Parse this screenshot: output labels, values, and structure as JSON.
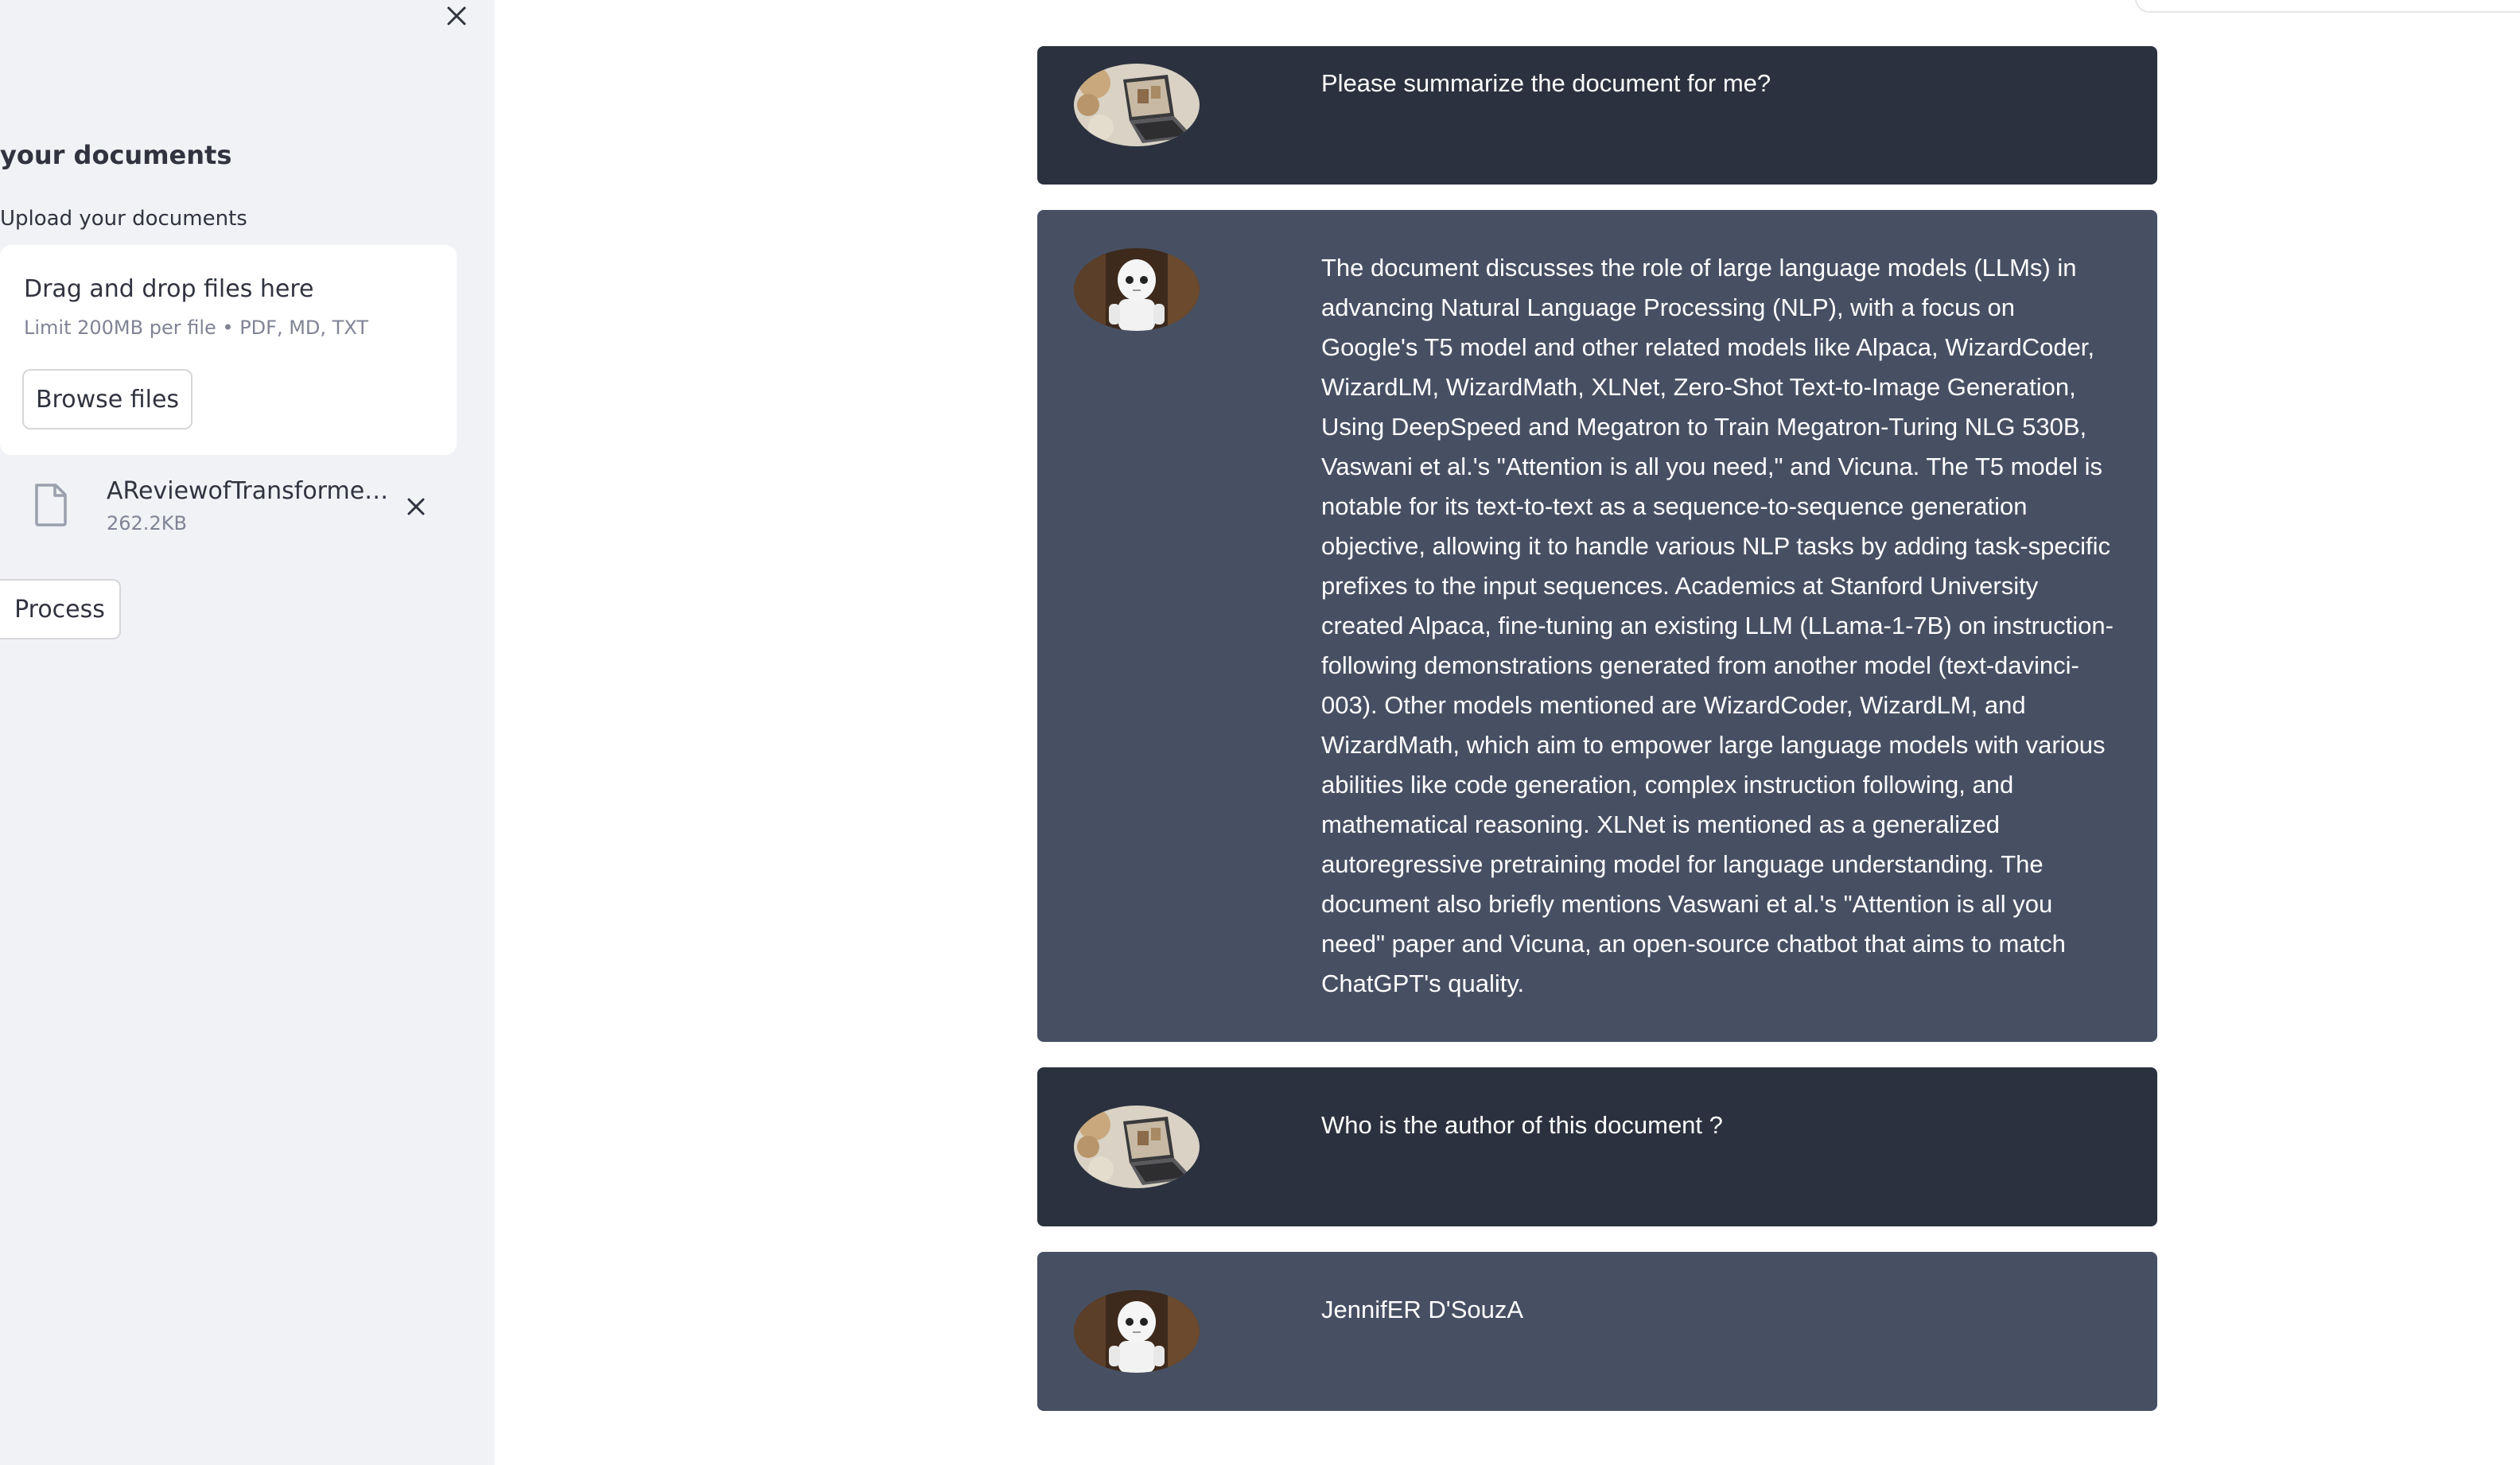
{
  "sidebar": {
    "title": "your documents",
    "upload_label": "Upload your documents",
    "dropzone": {
      "title": "Drag and drop files here",
      "limit": "Limit 200MB per file • PDF, MD, TXT",
      "browse_label": "Browse files"
    },
    "file": {
      "name": "AReviewofTransformerM...",
      "size": "262.2KB"
    },
    "process_label": "Process"
  },
  "chat": {
    "messages": [
      {
        "role": "user",
        "avatar": "user-laptop-avatar",
        "text": "Please summarize the document for me?"
      },
      {
        "role": "bot",
        "avatar": "bot-robot-avatar",
        "text": "The document discusses the role of large language models (LLMs) in advancing Natural Language Processing (NLP), with a focus on Google's T5 model and other related models like Alpaca, WizardCoder, WizardLM, WizardMath, XLNet, Zero-Shot Text-to-Image Generation, Using DeepSpeed and Megatron to Train Megatron-Turing NLG 530B, Vaswani et al.'s \"Attention is all you need,\" and Vicuna. The T5 model is notable for its text-to-text as a sequence-to-sequence generation objective, allowing it to handle various NLP tasks by adding task-specific prefixes to the input sequences. Academics at Stanford University created Alpaca, fine-tuning an existing LLM (LLama-1-7B) on instruction-following demonstrations generated from another model (text-davinci-003). Other models mentioned are WizardCoder, WizardLM, and WizardMath, which aim to empower large language models with various abilities like code generation, complex instruction following, and mathematical reasoning. XLNet is mentioned as a generalized autoregressive pretraining model for language understanding. The document also briefly mentions Vaswani et al.'s \"Attention is all you need\" paper and Vicuna, an open-source chatbot that aims to match ChatGPT's quality."
      },
      {
        "role": "user",
        "avatar": "user-laptop-avatar",
        "text": "Who is the author of this document ?"
      },
      {
        "role": "bot",
        "avatar": "bot-robot-avatar",
        "text": "JennifER D'SouzA"
      }
    ]
  },
  "colors": {
    "sidebar_bg": "#f0f2f6",
    "user_msg_bg": "#2b313e",
    "bot_msg_bg": "#475063",
    "text_dark": "#31333f",
    "text_muted": "#808495"
  }
}
